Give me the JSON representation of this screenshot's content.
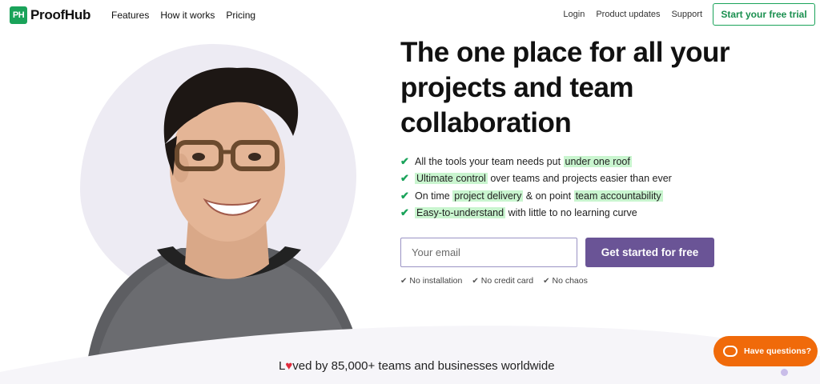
{
  "header": {
    "logo_mark": "PH",
    "logo_text": "ProofHub",
    "nav_left": [
      "Features",
      "How it works",
      "Pricing"
    ],
    "nav_right": [
      "Login",
      "Product updates",
      "Support"
    ],
    "trial_label": "Start your free trial"
  },
  "hero": {
    "headline": "The one place for all your projects and team collaboration",
    "features": [
      {
        "before": "All the tools your team needs put ",
        "hl": "under one roof",
        "mid": "",
        "hl2": "",
        "after": ""
      },
      {
        "before": "",
        "hl": "Ultimate control",
        "mid": " over teams and projects easier than ever",
        "hl2": "",
        "after": ""
      },
      {
        "before": "On time ",
        "hl": "project delivery",
        "mid": " & on point ",
        "hl2": "team accountability",
        "after": ""
      },
      {
        "before": "",
        "hl": "Easy-to-understand",
        "mid": " with little to no learning curve",
        "hl2": "",
        "after": ""
      }
    ],
    "email_placeholder": "Your email",
    "cta_label": "Get started for free",
    "perks": [
      "No installation",
      "No credit card",
      "No chaos"
    ]
  },
  "social_proof": {
    "prefix": "L",
    "suffix": "ved by 85,000+ teams and businesses worldwide"
  },
  "chat": {
    "label": "Have questions?"
  },
  "colors": {
    "brand_green": "#1aa35a",
    "cta_purple": "#6a5496",
    "chat_orange": "#f06a0a",
    "highlight": "#c9f5cf"
  }
}
